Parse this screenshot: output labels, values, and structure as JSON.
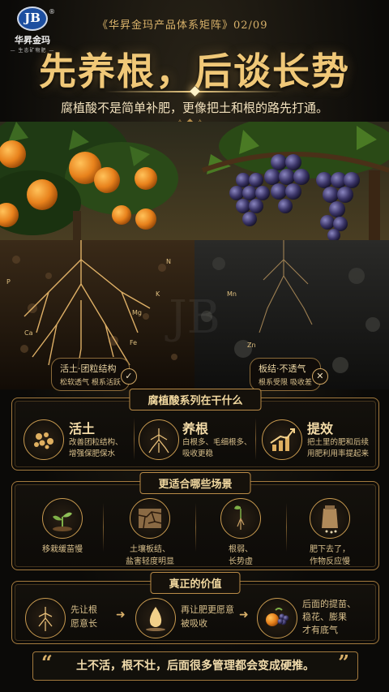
{
  "brand": {
    "mark": "JB",
    "name": "华昇金玛",
    "tagline": "— 生态矿物肥 —",
    "registered": "®"
  },
  "header": {
    "series": "《华昇金玛产品体系矩阵》02/09",
    "title": "先养根，后谈长势",
    "subtitle": "腐植酸不是简单补肥，更像把土和根的路先打通。"
  },
  "hero": {
    "nutrients": [
      "P",
      "N",
      "K",
      "Mg",
      "Ca",
      "Fe",
      "Mn",
      "Zn"
    ],
    "left_tag": {
      "title": "活土·团粒结构",
      "sub": "松软透气  根系活跃",
      "icon": "check-icon"
    },
    "right_tag": {
      "title": "板结·不透气",
      "sub": "根系受限  吸收差",
      "icon": "cross-icon"
    }
  },
  "section1": {
    "heading": "腐植酸系列在干什么",
    "items": [
      {
        "title": "活土",
        "desc": [
          "改善团粒结构、",
          "增强保肥保水"
        ],
        "icon": "soil-granules-icon"
      },
      {
        "title": "养根",
        "desc": [
          "白根多、毛细根多、",
          "吸收更稳"
        ],
        "icon": "roots-icon"
      },
      {
        "title": "提效",
        "desc": [
          "把土里的肥和后续",
          "用肥利用率提起来"
        ],
        "icon": "growth-chart-icon"
      }
    ]
  },
  "section2": {
    "heading": "更适合哪些场景",
    "items": [
      {
        "text": [
          "移栽缓苗慢"
        ],
        "icon": "seedling-icon"
      },
      {
        "text": [
          "土壤板结、",
          "盐害轻度明显"
        ],
        "icon": "cracked-soil-icon"
      },
      {
        "text": [
          "根弱、",
          "长势虚"
        ],
        "icon": "weak-root-icon"
      },
      {
        "text": [
          "肥下去了，",
          "作物反应慢"
        ],
        "icon": "fertilizer-bag-icon"
      }
    ]
  },
  "section3": {
    "heading": "真正的价值",
    "items": [
      {
        "text": [
          "先让根",
          "愿意长"
        ],
        "icon": "root-icon"
      },
      {
        "text": [
          "再让肥更愿意",
          "被吸收"
        ],
        "icon": "droplet-icon"
      },
      {
        "text": [
          "后面的提苗、",
          "稳花、膨果",
          "才有底气"
        ],
        "icon": "fruit-icon"
      }
    ]
  },
  "quote": {
    "text": "土不活，根不壮，后面很多管理都会变成硬推。",
    "open": "“",
    "close": "”"
  },
  "colors": {
    "gold": "#d9b06a",
    "background": "#0b0a08",
    "orange": "#e8821c",
    "grape": "#3a3466"
  }
}
